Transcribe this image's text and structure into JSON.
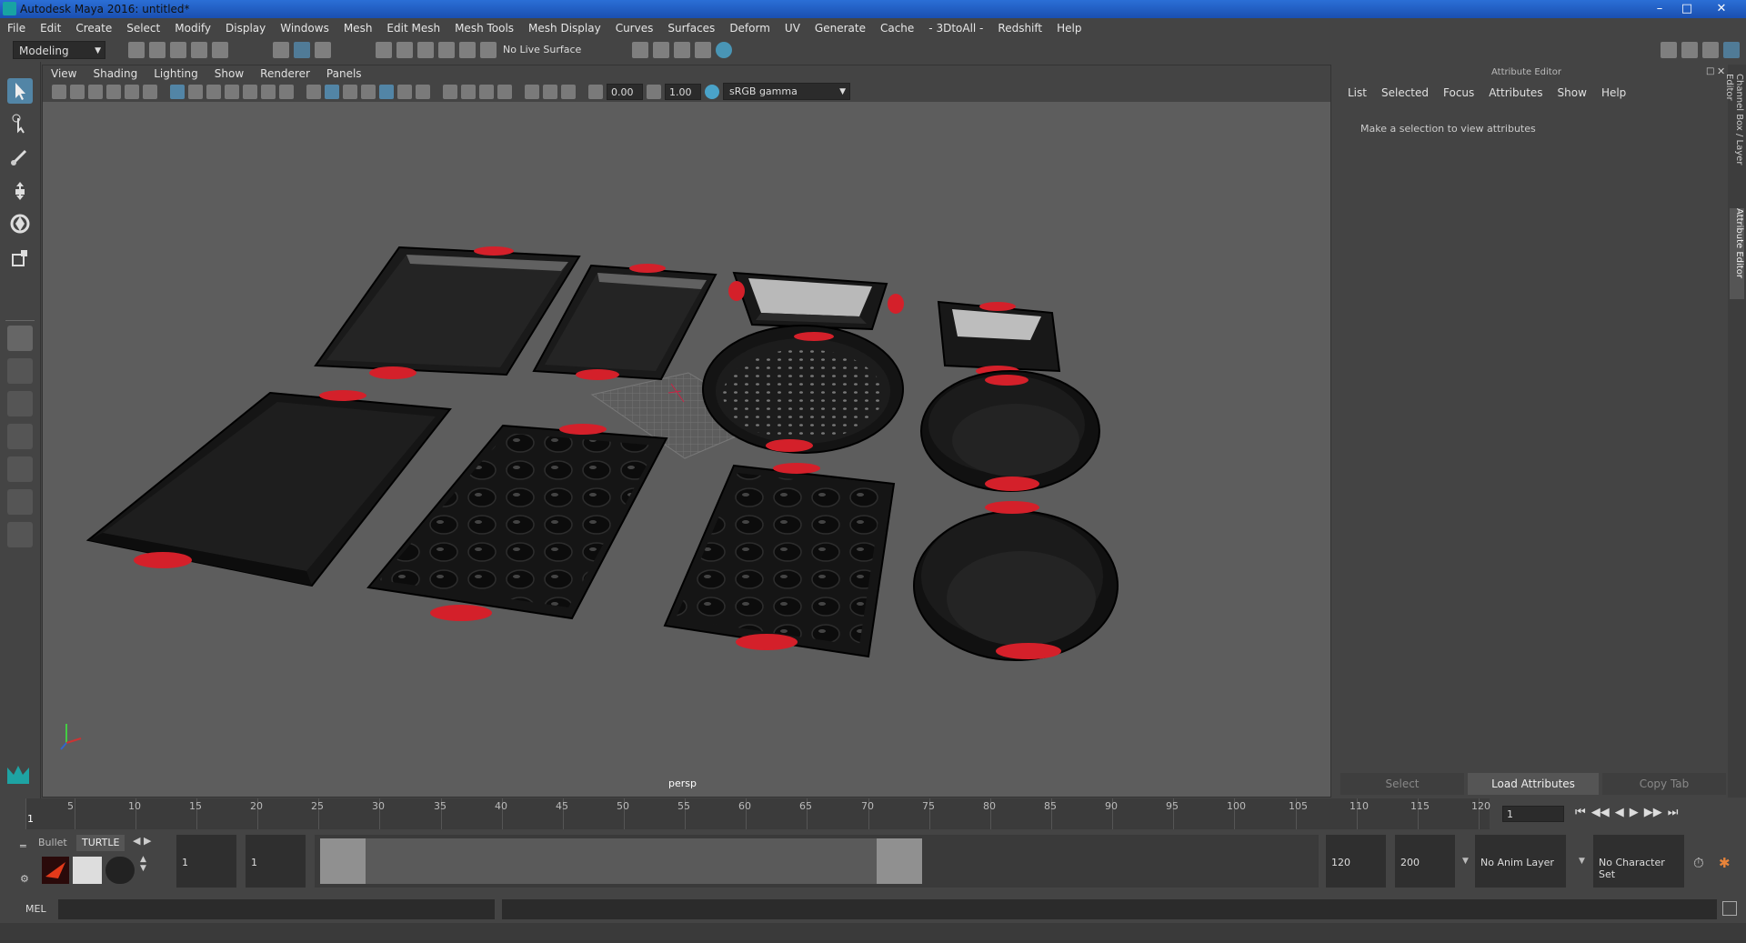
{
  "window": {
    "title": "Autodesk Maya 2016: untitled*"
  },
  "menu": [
    "File",
    "Edit",
    "Create",
    "Select",
    "Modify",
    "Display",
    "Windows",
    "Mesh",
    "Edit Mesh",
    "Mesh Tools",
    "Mesh Display",
    "Curves",
    "Surfaces",
    "Deform",
    "UV",
    "Generate",
    "Cache",
    "- 3DtoAll -",
    "Redshift",
    "Help"
  ],
  "status": {
    "mode": "Modeling",
    "live_surface": "No Live Surface"
  },
  "viewport": {
    "menu": [
      "View",
      "Shading",
      "Lighting",
      "Show",
      "Renderer",
      "Panels"
    ],
    "exposure": "0.00",
    "gamma": "1.00",
    "color_space": "sRGB gamma",
    "camera_label": "persp"
  },
  "attribute_editor": {
    "title": "Attribute Editor",
    "tabs": [
      "List",
      "Selected",
      "Focus",
      "Attributes",
      "Show",
      "Help"
    ],
    "message": "Make a selection to view attributes",
    "buttons": {
      "select": "Select",
      "load": "Load Attributes",
      "copy": "Copy Tab"
    },
    "side_tabs": [
      "Channel Box / Layer Editor",
      "Attribute Editor"
    ]
  },
  "timeline": {
    "ticks": [
      1,
      5,
      10,
      15,
      20,
      25,
      30,
      35,
      40,
      45,
      50,
      55,
      60,
      65,
      70,
      75,
      80,
      85,
      90,
      95,
      100,
      105,
      110,
      115,
      120
    ],
    "current_frame": "1"
  },
  "range": {
    "shelf_tabs": [
      "Bullet",
      "TURTLE"
    ],
    "start": "1",
    "anim_start": "1",
    "range_start_label": "1",
    "range_end_label": "120",
    "anim_end": "120",
    "end": "200",
    "anim_layer": "No Anim Layer",
    "character_set": "No Character Set"
  },
  "command": {
    "label": "MEL"
  },
  "colors": {
    "accent": "#5285a6",
    "handle_red": "#d4202a"
  }
}
